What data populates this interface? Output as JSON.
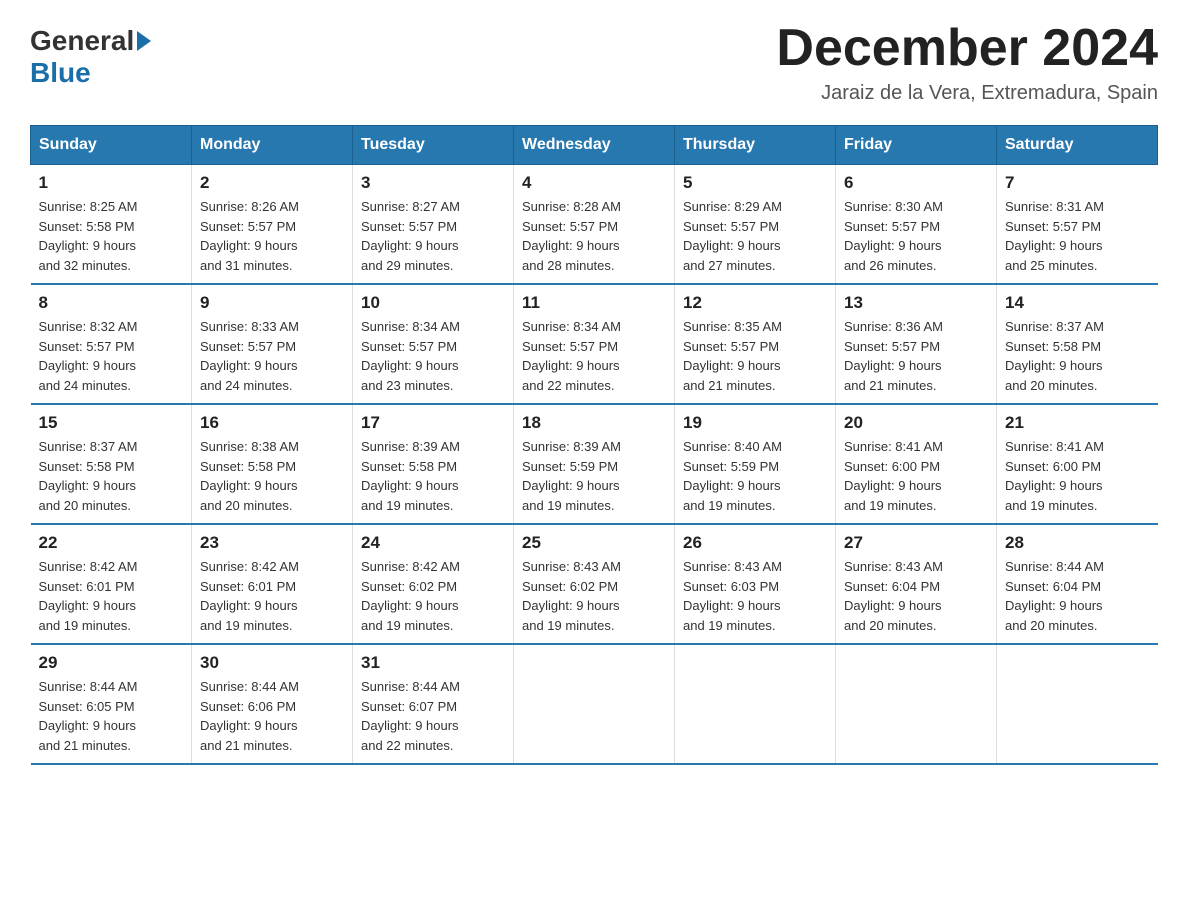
{
  "header": {
    "logo_general": "General",
    "logo_blue": "Blue",
    "month_title": "December 2024",
    "subtitle": "Jaraiz de la Vera, Extremadura, Spain"
  },
  "days_of_week": [
    "Sunday",
    "Monday",
    "Tuesday",
    "Wednesday",
    "Thursday",
    "Friday",
    "Saturday"
  ],
  "weeks": [
    [
      {
        "day": "1",
        "sunrise": "8:25 AM",
        "sunset": "5:58 PM",
        "daylight": "9 hours and 32 minutes."
      },
      {
        "day": "2",
        "sunrise": "8:26 AM",
        "sunset": "5:57 PM",
        "daylight": "9 hours and 31 minutes."
      },
      {
        "day": "3",
        "sunrise": "8:27 AM",
        "sunset": "5:57 PM",
        "daylight": "9 hours and 29 minutes."
      },
      {
        "day": "4",
        "sunrise": "8:28 AM",
        "sunset": "5:57 PM",
        "daylight": "9 hours and 28 minutes."
      },
      {
        "day": "5",
        "sunrise": "8:29 AM",
        "sunset": "5:57 PM",
        "daylight": "9 hours and 27 minutes."
      },
      {
        "day": "6",
        "sunrise": "8:30 AM",
        "sunset": "5:57 PM",
        "daylight": "9 hours and 26 minutes."
      },
      {
        "day": "7",
        "sunrise": "8:31 AM",
        "sunset": "5:57 PM",
        "daylight": "9 hours and 25 minutes."
      }
    ],
    [
      {
        "day": "8",
        "sunrise": "8:32 AM",
        "sunset": "5:57 PM",
        "daylight": "9 hours and 24 minutes."
      },
      {
        "day": "9",
        "sunrise": "8:33 AM",
        "sunset": "5:57 PM",
        "daylight": "9 hours and 24 minutes."
      },
      {
        "day": "10",
        "sunrise": "8:34 AM",
        "sunset": "5:57 PM",
        "daylight": "9 hours and 23 minutes."
      },
      {
        "day": "11",
        "sunrise": "8:34 AM",
        "sunset": "5:57 PM",
        "daylight": "9 hours and 22 minutes."
      },
      {
        "day": "12",
        "sunrise": "8:35 AM",
        "sunset": "5:57 PM",
        "daylight": "9 hours and 21 minutes."
      },
      {
        "day": "13",
        "sunrise": "8:36 AM",
        "sunset": "5:57 PM",
        "daylight": "9 hours and 21 minutes."
      },
      {
        "day": "14",
        "sunrise": "8:37 AM",
        "sunset": "5:58 PM",
        "daylight": "9 hours and 20 minutes."
      }
    ],
    [
      {
        "day": "15",
        "sunrise": "8:37 AM",
        "sunset": "5:58 PM",
        "daylight": "9 hours and 20 minutes."
      },
      {
        "day": "16",
        "sunrise": "8:38 AM",
        "sunset": "5:58 PM",
        "daylight": "9 hours and 20 minutes."
      },
      {
        "day": "17",
        "sunrise": "8:39 AM",
        "sunset": "5:58 PM",
        "daylight": "9 hours and 19 minutes."
      },
      {
        "day": "18",
        "sunrise": "8:39 AM",
        "sunset": "5:59 PM",
        "daylight": "9 hours and 19 minutes."
      },
      {
        "day": "19",
        "sunrise": "8:40 AM",
        "sunset": "5:59 PM",
        "daylight": "9 hours and 19 minutes."
      },
      {
        "day": "20",
        "sunrise": "8:41 AM",
        "sunset": "6:00 PM",
        "daylight": "9 hours and 19 minutes."
      },
      {
        "day": "21",
        "sunrise": "8:41 AM",
        "sunset": "6:00 PM",
        "daylight": "9 hours and 19 minutes."
      }
    ],
    [
      {
        "day": "22",
        "sunrise": "8:42 AM",
        "sunset": "6:01 PM",
        "daylight": "9 hours and 19 minutes."
      },
      {
        "day": "23",
        "sunrise": "8:42 AM",
        "sunset": "6:01 PM",
        "daylight": "9 hours and 19 minutes."
      },
      {
        "day": "24",
        "sunrise": "8:42 AM",
        "sunset": "6:02 PM",
        "daylight": "9 hours and 19 minutes."
      },
      {
        "day": "25",
        "sunrise": "8:43 AM",
        "sunset": "6:02 PM",
        "daylight": "9 hours and 19 minutes."
      },
      {
        "day": "26",
        "sunrise": "8:43 AM",
        "sunset": "6:03 PM",
        "daylight": "9 hours and 19 minutes."
      },
      {
        "day": "27",
        "sunrise": "8:43 AM",
        "sunset": "6:04 PM",
        "daylight": "9 hours and 20 minutes."
      },
      {
        "day": "28",
        "sunrise": "8:44 AM",
        "sunset": "6:04 PM",
        "daylight": "9 hours and 20 minutes."
      }
    ],
    [
      {
        "day": "29",
        "sunrise": "8:44 AM",
        "sunset": "6:05 PM",
        "daylight": "9 hours and 21 minutes."
      },
      {
        "day": "30",
        "sunrise": "8:44 AM",
        "sunset": "6:06 PM",
        "daylight": "9 hours and 21 minutes."
      },
      {
        "day": "31",
        "sunrise": "8:44 AM",
        "sunset": "6:07 PM",
        "daylight": "9 hours and 22 minutes."
      },
      null,
      null,
      null,
      null
    ]
  ],
  "cell_labels": {
    "sunrise": "Sunrise:",
    "sunset": "Sunset:",
    "daylight": "Daylight:"
  }
}
